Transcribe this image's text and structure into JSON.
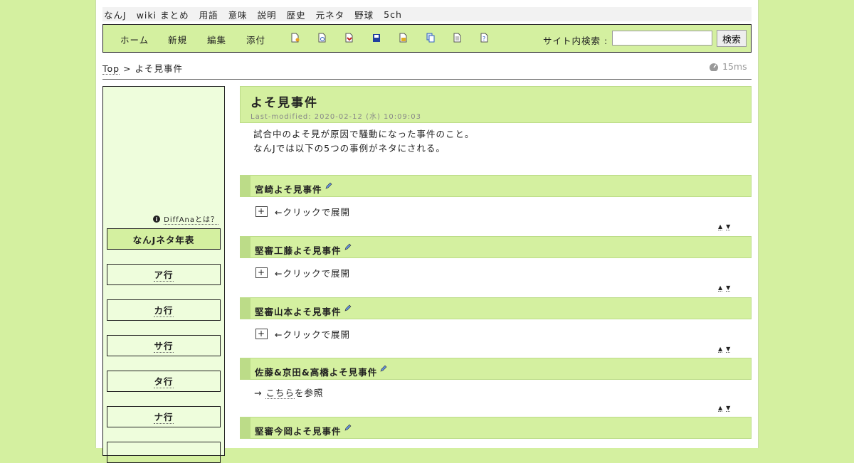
{
  "topnav": [
    "なんJ",
    "wiki まとめ",
    "用語",
    "意味",
    "説明",
    "歴史",
    "元ネタ",
    "野球",
    "5ch"
  ],
  "toolbar": {
    "buttons": [
      "ホーム",
      "新規",
      "編集",
      "添付"
    ],
    "icons": [
      "new-page-icon",
      "search-page-icon",
      "diff-icon",
      "save-icon",
      "lock-icon",
      "copy-icon",
      "list-icon",
      "help-icon"
    ],
    "search_label": "サイト内検索 :",
    "search_value": "",
    "search_button": "検索"
  },
  "breadcrumb": {
    "home": "Top",
    "sep": ">",
    "current": "よそ見事件"
  },
  "timing": "15ms",
  "sidebar": {
    "diffana": "DiffAnaとは？",
    "items": [
      "なんJネタ年表",
      "ア行",
      "カ行",
      "サ行",
      "タ行",
      "ナ行"
    ]
  },
  "page": {
    "title": "よそ見事件",
    "last_modified": "Last-modified: 2020-02-12 (水) 10:09:03",
    "intro": [
      "試合中のよそ見が原因で騒動になった事件のこと。",
      "なんJでは以下の5つの事例がネタにされる。"
    ],
    "expand_plus": "+",
    "expand_text": "←クリックで展開",
    "arrow_up": "▲",
    "arrow_down": "▼",
    "sections": [
      {
        "title": "宮崎よそ見事件"
      },
      {
        "title": "堅審工藤よそ見事件"
      },
      {
        "title": "堅審山本よそ見事件"
      },
      {
        "title": "佐藤&京田&高橋よそ見事件",
        "ref_arrow": "→",
        "ref_link": "こちら",
        "ref_suffix": "を参照"
      },
      {
        "title": "堅審今岡よそ見事件"
      }
    ]
  },
  "colors": {
    "background": "#d4f0a0",
    "sidebar": "#eefddc",
    "accent_border": "#bcdc88"
  }
}
